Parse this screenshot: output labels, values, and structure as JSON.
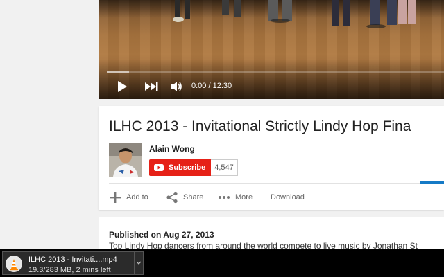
{
  "player": {
    "time_display": "0:00 / 12:30",
    "progress_loaded_fraction": 0.065
  },
  "video": {
    "title": "ILHC 2013 - Invitational Strictly Lindy Hop Fina"
  },
  "channel": {
    "name": "Alain Wong",
    "subscribe_label": "Subscribe",
    "subscriber_count": "4,547"
  },
  "actions": {
    "add_to": "Add to",
    "share": "Share",
    "more": "More",
    "download": "Download"
  },
  "description": {
    "published": "Published on Aug 27, 2013",
    "text": "Top Lindy Hop dancers from around the world compete to live music by Jonathan St"
  },
  "download_bar": {
    "filename": "ILHC 2013 - Invitati....mp4",
    "status": "19.3/283 MB, 2 mins left"
  },
  "colors": {
    "subscribe_red": "#e62117",
    "like_blue": "#167ac6"
  }
}
